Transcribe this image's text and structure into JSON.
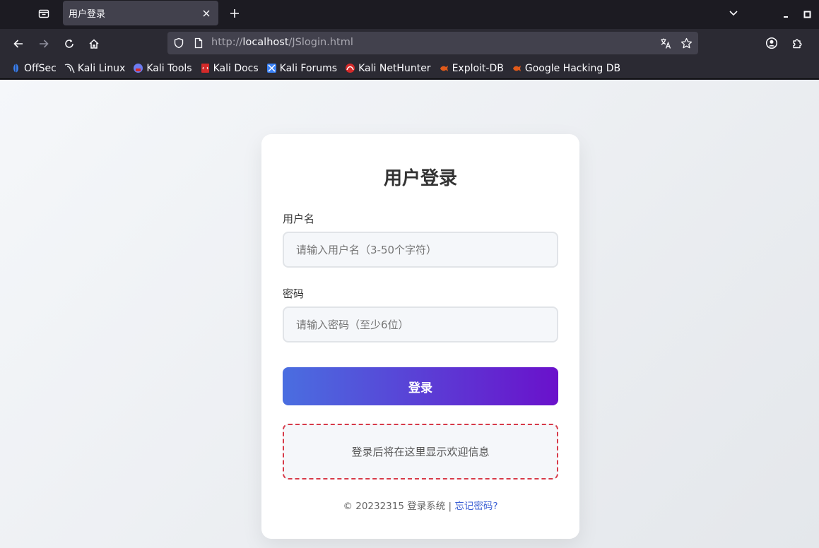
{
  "browser": {
    "tab_title": "用户登录",
    "url": {
      "scheme": "http://",
      "host": "localhost",
      "path": "/JSlogin.html"
    },
    "bookmarks": [
      {
        "label": "OffSec",
        "icon": "offsec-icon",
        "color": "#3b82f6"
      },
      {
        "label": "Kali Linux",
        "icon": "kali-dragon-icon",
        "color": "#e5e7eb"
      },
      {
        "label": "Kali Tools",
        "icon": "kali-tools-icon",
        "color": "#6d7cf0"
      },
      {
        "label": "Kali Docs",
        "icon": "kali-docs-icon",
        "color": "#d42a2a"
      },
      {
        "label": "Kali Forums",
        "icon": "kali-forums-icon",
        "color": "#3b82f6"
      },
      {
        "label": "Kali NetHunter",
        "icon": "nethunter-icon",
        "color": "#d42a2a"
      },
      {
        "label": "Exploit-DB",
        "icon": "exploit-db-icon",
        "color": "#e05a1a"
      },
      {
        "label": "Google Hacking DB",
        "icon": "ghdb-icon",
        "color": "#e05a1a"
      }
    ]
  },
  "login": {
    "title": "用户登录",
    "username_label": "用户名",
    "username_placeholder": "请输入用户名（3-50个字符）",
    "username_value": "",
    "password_label": "密码",
    "password_placeholder": "请输入密码（至少6位）",
    "password_value": "",
    "submit_label": "登录",
    "welcome_text": "登录后将在这里显示欢迎信息",
    "footer_text": "© 20232315 登录系统 |",
    "footer_link": "忘记密码?"
  },
  "colors": {
    "button_gradient_start": "#4a6ee0",
    "button_gradient_end": "#6a11cb",
    "welcome_border": "#d73a49",
    "link": "#3b5fd4"
  }
}
